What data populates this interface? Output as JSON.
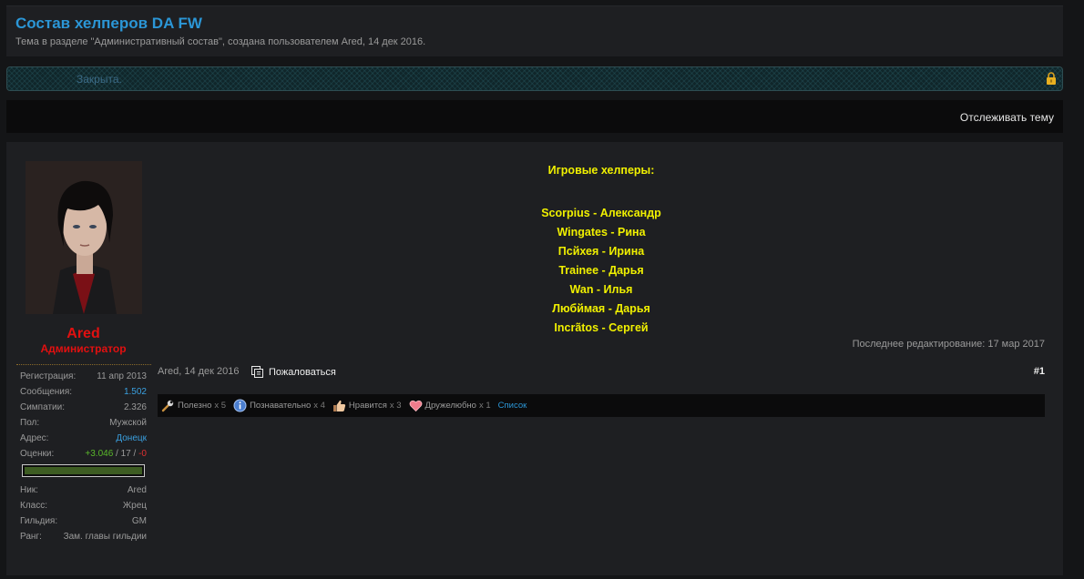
{
  "thread": {
    "title": "Состав хелперов DA FW",
    "description": "Тема в разделе \"Административный состав\", создана пользователем Ared, 14 дек 2016."
  },
  "status": {
    "closed_text": "Закрыта.",
    "icon": "lock-icon"
  },
  "actions": {
    "follow_label": "Отслеживать тему"
  },
  "author": {
    "name": "Ared",
    "title": "Администратор",
    "name_color": "#e21010",
    "stats": [
      {
        "key": "Регистрация:",
        "value": "11 апр 2013"
      },
      {
        "key": "Сообщения:",
        "value": "1.502"
      },
      {
        "key": "Симпатии:",
        "value": "2.326"
      },
      {
        "key": "Пол:",
        "value": "Мужской"
      },
      {
        "key": "Адрес:",
        "value": "Донецк"
      }
    ],
    "ratings_label": "Оценки:",
    "ratings_positive": "+3.046",
    "ratings_sep1": " / ",
    "ratings_neutral": "17",
    "ratings_sep2": " / ",
    "ratings_negative": "-0",
    "rating_level": 1.0,
    "fields": [
      {
        "key": "Ник:",
        "value": "Ared"
      },
      {
        "key": "Класс:",
        "value": "Жрец"
      },
      {
        "key": "Гильдия:",
        "value": "GM"
      },
      {
        "key": "Ранг:",
        "value": "Зам. главы гильдии"
      }
    ]
  },
  "message": {
    "heading": "Игровые хелперы:",
    "lines": [
      "Scorpius - Александр",
      "Wingates - Рина",
      "Псйхея - Ирина",
      "Trainee - Дарья",
      "Wan - Илья",
      "Любймая - Дарья",
      "Incrãtos - Сергей"
    ],
    "text_color": "#f0f000"
  },
  "post": {
    "last_edit": "Последнее редактирование: 17 мар 2017",
    "meta": "Ared, 14 дек 2016",
    "report_label": "Пожаловаться",
    "number": "#1"
  },
  "reactions": {
    "items": [
      {
        "icon": "wrench-icon",
        "label": "Полезно",
        "count": "x 5"
      },
      {
        "icon": "info-icon",
        "label": "Познавательно",
        "count": "x 4"
      },
      {
        "icon": "thumbs-up-icon",
        "label": "Нравится",
        "count": "x 3"
      },
      {
        "icon": "heart-icon",
        "label": "Дружелюбно",
        "count": "x 1"
      }
    ],
    "list_label": "Список"
  }
}
